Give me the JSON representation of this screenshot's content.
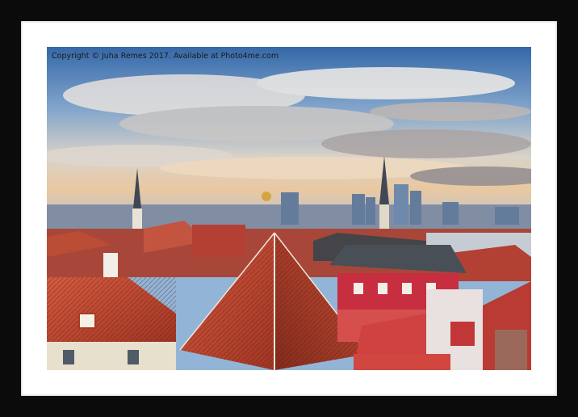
{
  "photo": {
    "copyright_text": "Copyright © Juha Remes 2017. Available at Photo4me.com",
    "subject": "rooftops-cityscape"
  },
  "colors": {
    "frame": "#0b0b0b",
    "mount": "#ffffff",
    "roof_red": "#c7432e",
    "sky_blue": "#4f7fb8"
  }
}
